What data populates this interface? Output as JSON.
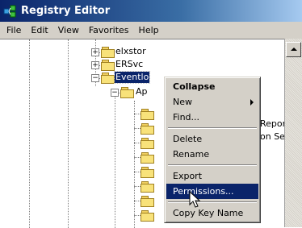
{
  "window": {
    "title": "Registry Editor"
  },
  "menu": [
    {
      "key": "file",
      "label": "File"
    },
    {
      "key": "edit",
      "label": "Edit"
    },
    {
      "key": "view",
      "label": "View"
    },
    {
      "key": "favorites",
      "label": "Favorites"
    },
    {
      "key": "help",
      "label": "Help"
    }
  ],
  "tree": {
    "nodes": [
      {
        "label": "elxstor",
        "expander": "+"
      },
      {
        "label": "ERSvc",
        "expander": "+"
      },
      {
        "label": "Eventlo",
        "expander": "−",
        "selected": true
      },
      {
        "label": "Ap",
        "expander": "−"
      }
    ],
    "right_text_1": "Repor",
    "right_text_2": "on Sei"
  },
  "context_menu": {
    "items": [
      {
        "key": "collapse",
        "label": "Collapse",
        "bold": true
      },
      {
        "key": "new",
        "label": "New",
        "submenu": true
      },
      {
        "key": "find",
        "label": "Find..."
      },
      {
        "sep": true
      },
      {
        "key": "delete",
        "label": "Delete"
      },
      {
        "key": "rename",
        "label": "Rename"
      },
      {
        "sep": true
      },
      {
        "key": "export",
        "label": "Export"
      },
      {
        "key": "permissions",
        "label": "Permissions...",
        "highlight": true
      },
      {
        "sep": true
      },
      {
        "key": "copy_key_name",
        "label": "Copy Key Name"
      }
    ]
  },
  "colors": {
    "title_bar": "#0a246a",
    "selection": "#0a246a",
    "menu_bg": "#d4d0c8"
  },
  "icons": {
    "app": "registry-editor-icon",
    "folder": "folder-icon",
    "scroll_up": "arrow-up-icon",
    "submenu": "chevron-right-icon",
    "cursor": "mouse-pointer-icon"
  }
}
